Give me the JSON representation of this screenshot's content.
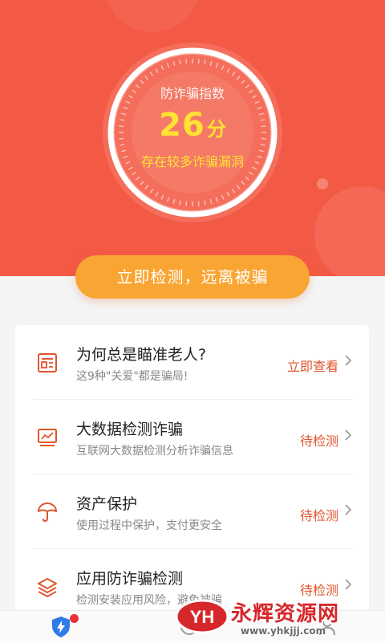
{
  "colors": {
    "hero_background": "#f35a45",
    "score_yellow": "#ffe234",
    "cta_orange": "#f9a533",
    "action_red": "#e0552e"
  },
  "gauge": {
    "title": "防诈骗指数",
    "score": "26",
    "unit": "分",
    "description": "存在较多诈骗漏洞"
  },
  "cta": {
    "label": "立即检测，远离被骗"
  },
  "items": [
    {
      "icon": "news-article-icon",
      "title": "为何总是瞄准老人?",
      "subtitle": "这9种\"关爱\"都是骗局!",
      "action": "立即查看"
    },
    {
      "icon": "chart-monitor-icon",
      "title": "大数据检测诈骗",
      "subtitle": "互联网大数据检测分析诈骗信息",
      "action": "待检测"
    },
    {
      "icon": "umbrella-icon",
      "title": "资产保护",
      "subtitle": "使用过程中保护，支付更安全",
      "action": "待检测"
    },
    {
      "icon": "layers-icon",
      "title": "应用防诈骗检测",
      "subtitle": "检测安装应用风险，避免被骗",
      "action": "待检测"
    }
  ],
  "tabbar": {
    "tabs": [
      {
        "icon": "shield-lightning-icon",
        "has_notification_dot": true
      },
      {
        "icon": "clock-icon"
      },
      {
        "icon": "user-icon"
      }
    ]
  },
  "watermark": {
    "text": "永辉资源网",
    "url": "www.yhkjjj.com",
    "badge": "YH"
  }
}
